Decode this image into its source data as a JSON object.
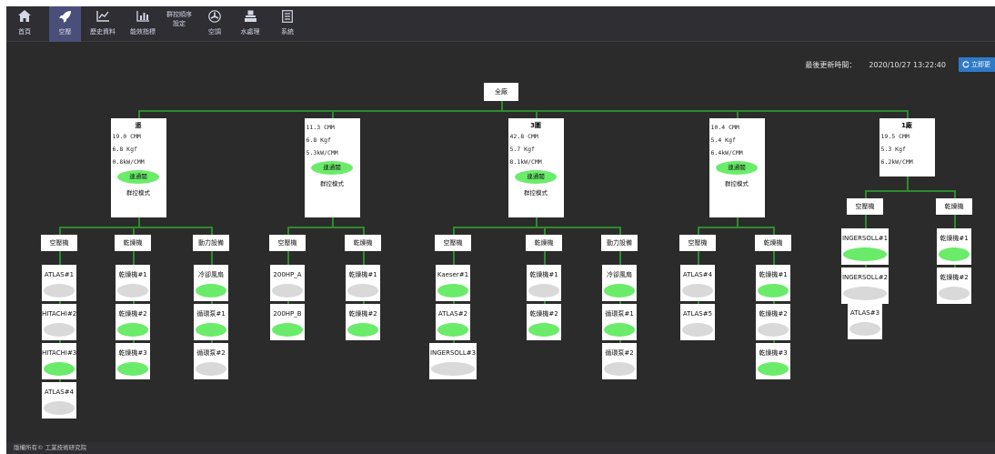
{
  "nav": [
    {
      "label": "首頁",
      "icon": "home-icon"
    },
    {
      "label": "空壓",
      "icon": "rocket-icon"
    },
    {
      "label": "歷史資料",
      "icon": "line-chart-icon"
    },
    {
      "label": "能效指標",
      "icon": "bar-chart-icon"
    },
    {
      "label": "群控順序\n設定",
      "icon": ""
    },
    {
      "label": "空調",
      "icon": "fan-icon"
    },
    {
      "label": "水處理",
      "icon": "water-icon"
    },
    {
      "label": "系統",
      "icon": "document-icon"
    }
  ],
  "status": {
    "label": "最後更新時間：",
    "time": "2020/10/27 13:22:40",
    "refresh": "立即更"
  },
  "root": "全廠",
  "groups": [
    {
      "title": "遥",
      "cmm": "19.0 CMM",
      "kgf": "6.8  Kgf",
      "eff": "0.8kW/CMM",
      "pill": "連通閥",
      "mode": "群控模式"
    },
    {
      "title": "",
      "cmm": "11.3 CMM",
      "kgf": "6.8  Kgf",
      "eff": "5.3kW/CMM",
      "pill": "連通閥",
      "mode": "群控模式"
    },
    {
      "title": "3圖",
      "cmm": "42.8 CMM",
      "kgf": "5.7  Kgf",
      "eff": "8.1kW/CMM",
      "pill": "連通閥",
      "mode": "群控模式"
    },
    {
      "title": "",
      "cmm": "10.4 CMM",
      "kgf": "5.4  Kgf",
      "eff": "6.4kW/CMM",
      "pill": "連通閥",
      "mode": "群控模式"
    },
    {
      "title": "1廠",
      "cmm": "19.5 CMM",
      "kgf": "5.3  Kgf",
      "eff": "6.2kW/CMM",
      "pill": "",
      "mode": ""
    }
  ],
  "categories": [
    "空壓機",
    "乾燥機",
    "動力設備",
    "空壓機",
    "乾燥機",
    "空壓機",
    "乾燥機",
    "動力設備",
    "空壓機",
    "乾燥機",
    "空壓機",
    "乾燥機"
  ],
  "machines": [
    {
      "label": "ATLAS#1",
      "on": false
    },
    {
      "label": "HITACHI#2",
      "on": false
    },
    {
      "label": "HITACHI#3",
      "on": true
    },
    {
      "label": "ATLAS#4",
      "on": false
    },
    {
      "label": "乾燥機#1",
      "on": false
    },
    {
      "label": "乾燥機#2",
      "on": true
    },
    {
      "label": "乾燥機#3",
      "on": true
    },
    {
      "label": "冷卻風扇",
      "on": true
    },
    {
      "label": "循環泵#1",
      "on": true
    },
    {
      "label": "循環泵#2",
      "on": false
    },
    {
      "label": "200HP_A",
      "on": false
    },
    {
      "label": "200HP_B",
      "on": true
    },
    {
      "label": "乾燥機#1",
      "on": false
    },
    {
      "label": "乾燥機#2",
      "on": true
    },
    {
      "label": "Kaeser#1",
      "on": true
    },
    {
      "label": "ATLAS#2",
      "on": true
    },
    {
      "label": "INGERSOLL#3",
      "on": false
    },
    {
      "label": "乾燥機#1",
      "on": false
    },
    {
      "label": "乾燥機#2",
      "on": true
    },
    {
      "label": "冷卻風扇",
      "on": true
    },
    {
      "label": "循環泵#1",
      "on": true
    },
    {
      "label": "循環泵#2",
      "on": false
    },
    {
      "label": "ATLAS#4",
      "on": false
    },
    {
      "label": "ATLAS#5",
      "on": false
    },
    {
      "label": "乾燥機#1",
      "on": true
    },
    {
      "label": "乾燥機#2",
      "on": false
    },
    {
      "label": "乾燥機#3",
      "on": true
    },
    {
      "label": "INGERSOLL#1",
      "on": true
    },
    {
      "label": "INGERSOLL#2",
      "on": false
    },
    {
      "label": "ATLAS#3",
      "on": false
    },
    {
      "label": "乾燥機#1",
      "on": true
    },
    {
      "label": "乾燥機#2",
      "on": false
    }
  ],
  "footer": "版權所有© 工業技術研究院",
  "colors": {
    "background": "#2b2b2b",
    "topbar": "#2e2e33",
    "active_tab": "#4a4f7a",
    "connector": "#2e8b2e",
    "running": "#6aec6a",
    "idle": "#d9d9d9",
    "refresh_button": "#2f7ac7"
  }
}
